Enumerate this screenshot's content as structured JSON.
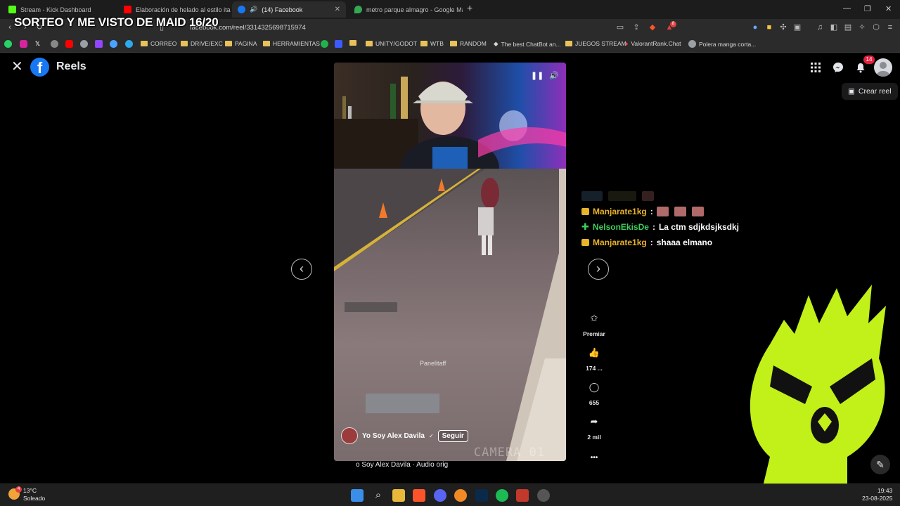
{
  "browser": {
    "tabs": [
      {
        "title": "Stream - Kick Dashboard",
        "favicon_color": "#53fc18"
      },
      {
        "title": "Elaboración de helado al estilo italia",
        "favicon_color": "#ff0000"
      },
      {
        "title": "(14) Facebook",
        "favicon_color": "#1877f2"
      },
      {
        "title": "metro parque almagro - Google Map",
        "favicon_color": "#34a853"
      }
    ],
    "url": "facebook.com/reel/3314325698715974",
    "bookmarks": [
      "CORREO",
      "DRIVE/EXC",
      "PAGINA",
      "HERRAMIENTAS",
      "UNITY/GODOT",
      "WTB",
      "RANDOM",
      "The best ChatBot an...",
      "JUEGOS STREAM",
      "ValorantRank.Chat",
      "Polera manga corta..."
    ],
    "extension_badge": "8"
  },
  "stream_overlay": {
    "title": "SORTEO Y ME VISTO DE MAID 16/20"
  },
  "facebook": {
    "section_title": "Reels",
    "logo_letter": "f",
    "notification_count": "14",
    "create_reel_label": "Crear reel",
    "reel": {
      "watermark": "Panelitaff",
      "camera_label": "CAMERA 01",
      "author_name": "Yo Soy Alex Davila",
      "follow_label": "Seguir",
      "audio_line": "o Soy Alex Davila · Audio orig"
    },
    "actions": {
      "premiar_label": "Premiar",
      "likes": "174 ...",
      "comments": "655",
      "shares": "2 mil",
      "more": "•••"
    }
  },
  "chat": {
    "messages": [
      {
        "user": "Manjarate1kg",
        "user_color": "#e9b32c",
        "badge": "crown",
        "text": "",
        "emotes": 3
      },
      {
        "user": "NelsonEkisDe",
        "user_color": "#3ecf5e",
        "badge": "plus",
        "text": "La ctm sdjkdsjksdkj",
        "emotes": 0
      },
      {
        "user": "Manjarate1kg",
        "user_color": "#e9b32c",
        "badge": "crown",
        "text": "shaaa elmano",
        "emotes": 0
      }
    ],
    "separator": ":"
  },
  "taskbar": {
    "weather_temp": "13°C",
    "weather_desc": "Soleado",
    "time": "19:43",
    "date": "23-08-2025",
    "weather_badge": "4"
  }
}
